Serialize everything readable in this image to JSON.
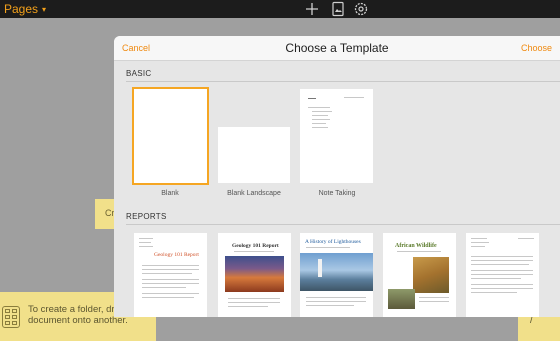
{
  "app": {
    "title": "Pages",
    "chevron": "chevron-down-icon",
    "toolbar_icons": [
      "add-icon",
      "media-icon",
      "settings-icon"
    ]
  },
  "background": {
    "folder_hint_text": "Cr",
    "note_text": "To create a folder, drag one document onto another.",
    "right_note_text": "/"
  },
  "sheet": {
    "cancel_label": "Cancel",
    "title": "Choose a Template",
    "choose_label": "Choose",
    "sections": [
      {
        "label": "BASIC",
        "templates": [
          {
            "label": "Blank",
            "selected": true
          },
          {
            "label": "Blank Landscape",
            "selected": false
          },
          {
            "label": "Note Taking",
            "selected": false
          }
        ]
      },
      {
        "label": "REPORTS",
        "templates": [
          {
            "title": "Geology 101 Report"
          },
          {
            "title": "Geology 101 Report"
          },
          {
            "title": "A History of Lighthouses"
          },
          {
            "title": "African Wildlife"
          },
          {
            "title": ""
          }
        ]
      }
    ]
  },
  "colors": {
    "accent": "#f08a10",
    "selection": "#f5a623",
    "topbar": "#1c1c1c",
    "sheet_bg": "#e6e6e6",
    "sticky_note": "#f1e08a"
  }
}
